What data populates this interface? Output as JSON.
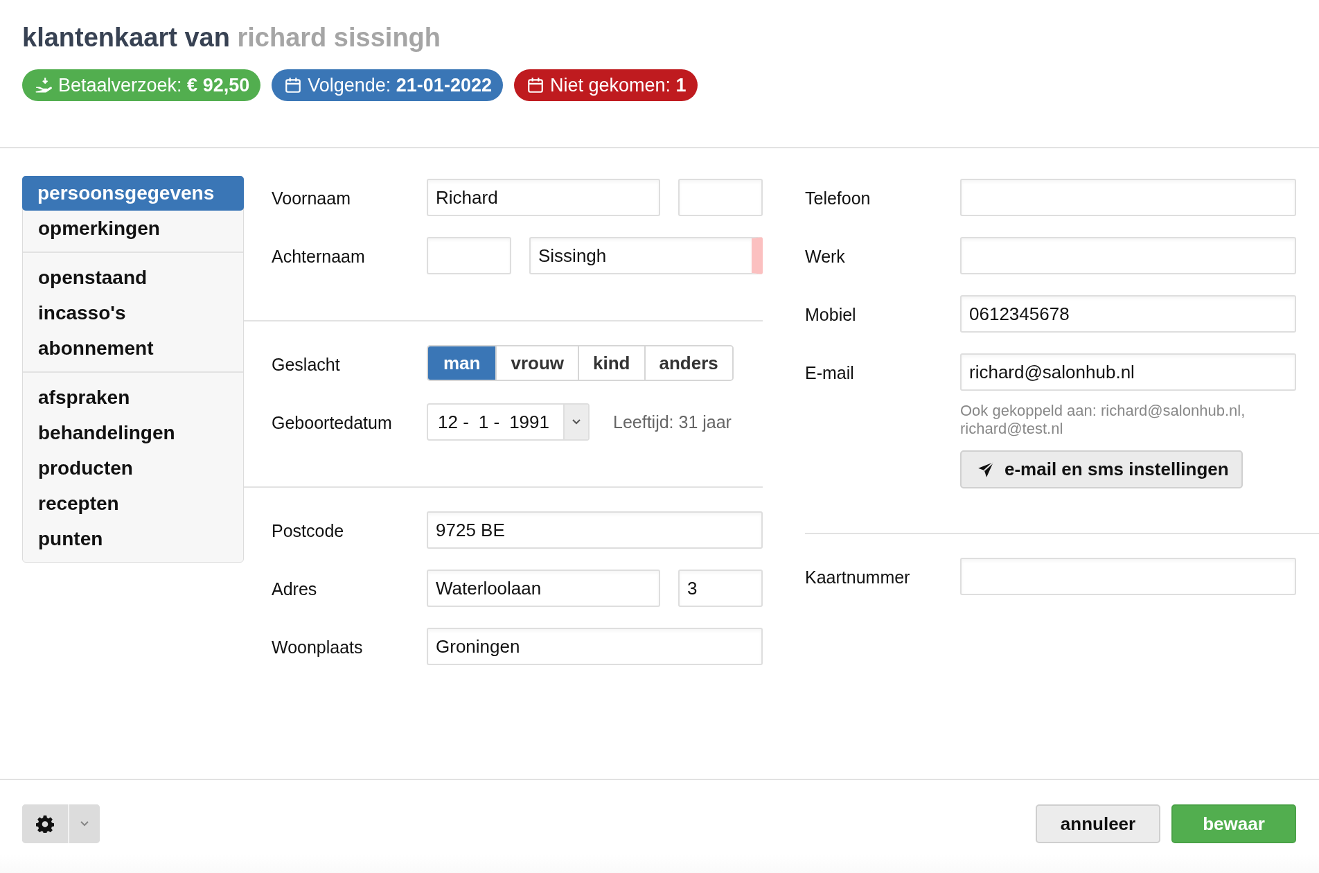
{
  "title": {
    "prefix": "klantenkaart van",
    "name": "richard sissingh"
  },
  "badges": [
    {
      "kind": "payment",
      "label": "Betaalverzoek:",
      "value": "€ 92,50",
      "color": "#52ae4f"
    },
    {
      "kind": "calendar",
      "label": "Volgende:",
      "value": "21-01-2022",
      "color": "#3a76b6"
    },
    {
      "kind": "calendar",
      "label": "Niet gekomen:",
      "value": "1",
      "color": "#bf1b1f"
    }
  ],
  "sidebar": {
    "groups": [
      {
        "items": [
          {
            "label": "persoonsgegevens",
            "selected": true
          },
          {
            "label": "opmerkingen",
            "selected": false
          }
        ]
      },
      {
        "items": [
          {
            "label": "openstaand",
            "selected": false
          },
          {
            "label": "incasso's",
            "selected": false
          },
          {
            "label": "abonnement",
            "selected": false
          }
        ]
      },
      {
        "items": [
          {
            "label": "afspraken",
            "selected": false
          },
          {
            "label": "behandelingen",
            "selected": false
          },
          {
            "label": "producten",
            "selected": false
          },
          {
            "label": "recepten",
            "selected": false
          },
          {
            "label": "punten",
            "selected": false
          }
        ]
      }
    ]
  },
  "form_left": [
    {
      "rows": [
        {
          "kind": "fields",
          "label": "Voornaam",
          "fields": [
            {
              "kind": "wide",
              "value": "Richard",
              "invalid": false
            },
            {
              "kind": "narrow",
              "invalid": false
            }
          ]
        },
        {
          "kind": "fields",
          "label": "Achternaam",
          "fields": [
            {
              "kind": "narrow",
              "invalid": false
            },
            {
              "kind": "wide",
              "value": "Sissingh",
              "invalid": true
            }
          ]
        }
      ]
    },
    {
      "rows": [
        {
          "kind": "segmented",
          "label": "Geslacht",
          "options": [
            {
              "label": "man",
              "selected": true
            },
            {
              "label": "vrouw",
              "selected": false
            },
            {
              "label": "kind",
              "selected": false
            },
            {
              "label": "anders",
              "selected": false
            }
          ]
        },
        {
          "kind": "date",
          "label": "Geboortedatum",
          "day": "12 -",
          "month": "1 -",
          "year": "1991",
          "note": "Leeftijd: 31 jaar"
        }
      ]
    },
    {
      "rows": [
        {
          "kind": "fields",
          "label": "Postcode",
          "fields": [
            {
              "value": "9725 BE",
              "invalid": false
            }
          ]
        },
        {
          "kind": "fields",
          "label": "Adres",
          "fields": [
            {
              "kind": "wide",
              "value": "Waterloolaan",
              "invalid": false
            },
            {
              "kind": "narrow",
              "value": "3",
              "invalid": false
            }
          ]
        },
        {
          "kind": "fields",
          "label": "Woonplaats",
          "fields": [
            {
              "value": "Groningen",
              "invalid": false
            }
          ]
        }
      ]
    }
  ],
  "form_right": [
    {
      "rows": [
        {
          "kind": "fields",
          "label": "Telefoon",
          "fields": [
            {
              "invalid": false
            }
          ]
        },
        {
          "kind": "fields",
          "label": "Werk",
          "fields": [
            {
              "invalid": false
            }
          ]
        },
        {
          "kind": "fields",
          "label": "Mobiel",
          "fields": [
            {
              "value": "0612345678",
              "invalid": false
            }
          ]
        },
        {
          "kind": "fields",
          "label": "E-mail",
          "fields": [
            {
              "value": "richard@salonhub.nl",
              "invalid": false
            }
          ],
          "note": "Ook gekoppeld aan: richard@salonhub.nl, richard@test.nl",
          "button": "e-mail en sms instellingen"
        }
      ]
    },
    {
      "rows": [
        {
          "kind": "fields",
          "label": "Kaartnummer",
          "fields": [
            {
              "invalid": false
            }
          ]
        }
      ]
    }
  ],
  "footer": {
    "buttons": [
      {
        "kind": "default",
        "label": "annuleer"
      },
      {
        "kind": "primary",
        "label": "bewaar"
      }
    ]
  }
}
